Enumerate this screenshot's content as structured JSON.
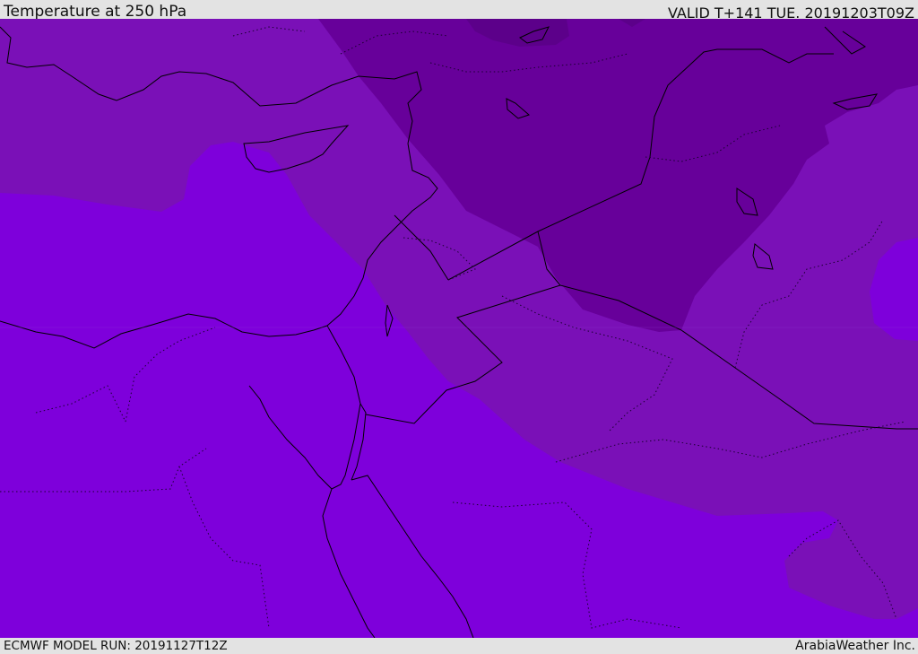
{
  "header": {
    "title": "Temperature at 250 hPa",
    "valid": "VALID T+141 TUE. 20191203T09Z"
  },
  "footer": {
    "model_run": "ECMWF MODEL RUN: 20191127T12Z",
    "credit": "ArabiaWeather Inc."
  },
  "colors": {
    "warmest_band": "#7e00db",
    "middle_band": "#7a10b7",
    "coolest_band": "#67009a",
    "core": "#5c008a",
    "coastline": "#000000",
    "background_bar": "#e3e3e3"
  }
}
